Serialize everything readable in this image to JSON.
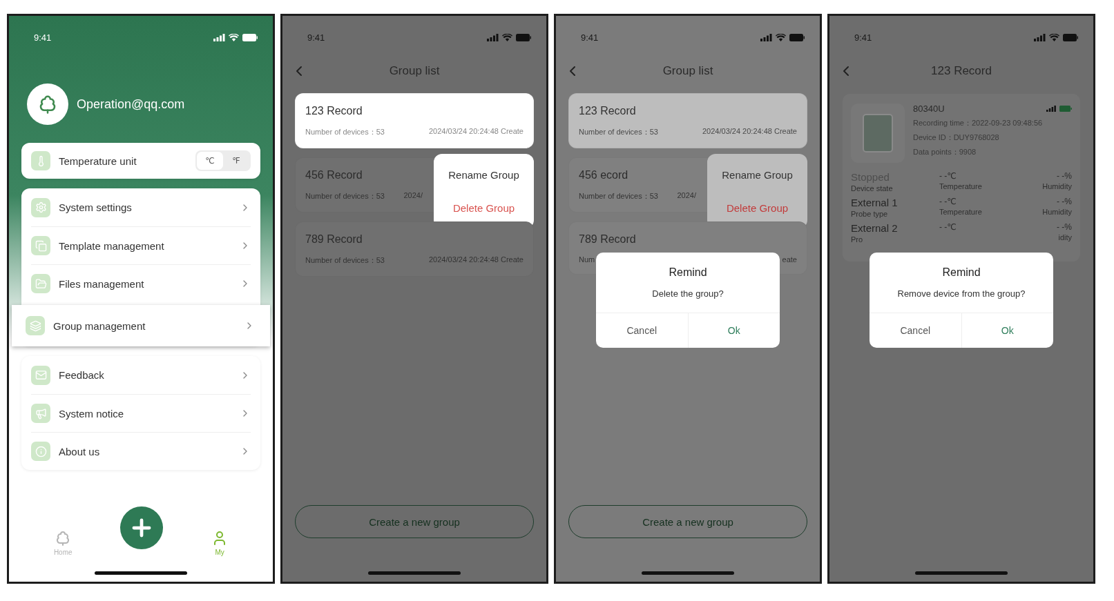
{
  "screens": [
    {
      "kind": "profile",
      "time": "9:41",
      "email": "Operation@qq.com",
      "temperature_unit": {
        "label": "Temperature unit",
        "options": [
          {
            "label": "℃",
            "selected": true
          },
          {
            "label": "℉",
            "selected": false
          }
        ]
      },
      "menu_groups": [
        {
          "items": [
            {
              "label": "System settings",
              "selected": false
            },
            {
              "label": "Template management",
              "selected": false
            },
            {
              "label": "Files management",
              "selected": false
            },
            {
              "label": "Group management",
              "selected": true
            }
          ]
        },
        {
          "items": [
            {
              "label": "Feedback",
              "selected": false
            },
            {
              "label": "System notice",
              "selected": false
            },
            {
              "label": "About us",
              "selected": false
            }
          ]
        }
      ],
      "tabs": [
        {
          "label": "Home",
          "selected": false
        },
        {
          "label": "My",
          "selected": true
        }
      ]
    },
    {
      "kind": "group_list",
      "time": "9:41",
      "title": "Group list",
      "groups": [
        {
          "name": "123 Record",
          "count": "Number of devices：53",
          "created": "2024/03/24 20:24:48 Create",
          "selected": true
        },
        {
          "name": "456 Record",
          "count": "Number of devices：53",
          "created": "2024/",
          "selected": false,
          "menu": [
            {
              "label": "Rename Group",
              "kind": "normal"
            },
            {
              "label": "Delete Group",
              "kind": "danger"
            }
          ]
        },
        {
          "name": "789 Record",
          "count": "Number of devices：53",
          "created": "2024/03/24 20:24:48 Create",
          "selected": false
        }
      ],
      "create_button": "Create a new group"
    },
    {
      "kind": "group_list",
      "time": "9:41",
      "title": "Group list",
      "groups": [
        {
          "name": "123 Record",
          "count": "Number of devices：53",
          "created": "2024/03/24 20:24:48 Create",
          "selected": true
        },
        {
          "name": "456 ecord",
          "count": "Number of devices：53",
          "created": "2024/",
          "selected": false,
          "menu": [
            {
              "label": "Rename Group",
              "kind": "normal"
            },
            {
              "label": "Delete Group",
              "kind": "danger"
            }
          ]
        },
        {
          "name": "789 Record",
          "count": "Num",
          "created": "eate",
          "selected": false
        }
      ],
      "create_button": "Create a new group",
      "dialog": {
        "title": "Remind",
        "message": "Delete the group?",
        "buttons": [
          {
            "label": "Cancel",
            "kind": "cancel"
          },
          {
            "label": "Ok",
            "kind": "confirm"
          }
        ]
      }
    },
    {
      "kind": "record",
      "time": "9:41",
      "title": "123 Record",
      "device": {
        "model": "80340U",
        "lines": [
          "Recording time：2022-09-23 09:48:56",
          "Device ID：DUY9768028",
          "Data points：9908"
        ]
      },
      "stats": [
        {
          "kind": "state",
          "cells": [
            {
              "value": "Stopped",
              "label": "Device state"
            },
            {
              "value": "- -℃",
              "label": "Temperature"
            },
            {
              "value": "- -%",
              "label": "Humidity"
            }
          ]
        },
        {
          "kind": "probe",
          "cells": [
            {
              "value": "External 1",
              "label": "Probe type"
            },
            {
              "value": "- -℃",
              "label": "Temperature"
            },
            {
              "value": "- -%",
              "label": "Humidity"
            }
          ]
        },
        {
          "kind": "probe",
          "cells": [
            {
              "value": "External 2",
              "label": "Pro"
            },
            {
              "value": "- -℃"
            },
            {
              "value": "- -%",
              "label": "idity"
            }
          ]
        }
      ],
      "dialog": {
        "title": "Remind",
        "message": "Remove device from the group?",
        "buttons": [
          {
            "label": "Cancel",
            "kind": "cancel"
          },
          {
            "label": "Ok",
            "kind": "confirm"
          }
        ]
      }
    }
  ]
}
